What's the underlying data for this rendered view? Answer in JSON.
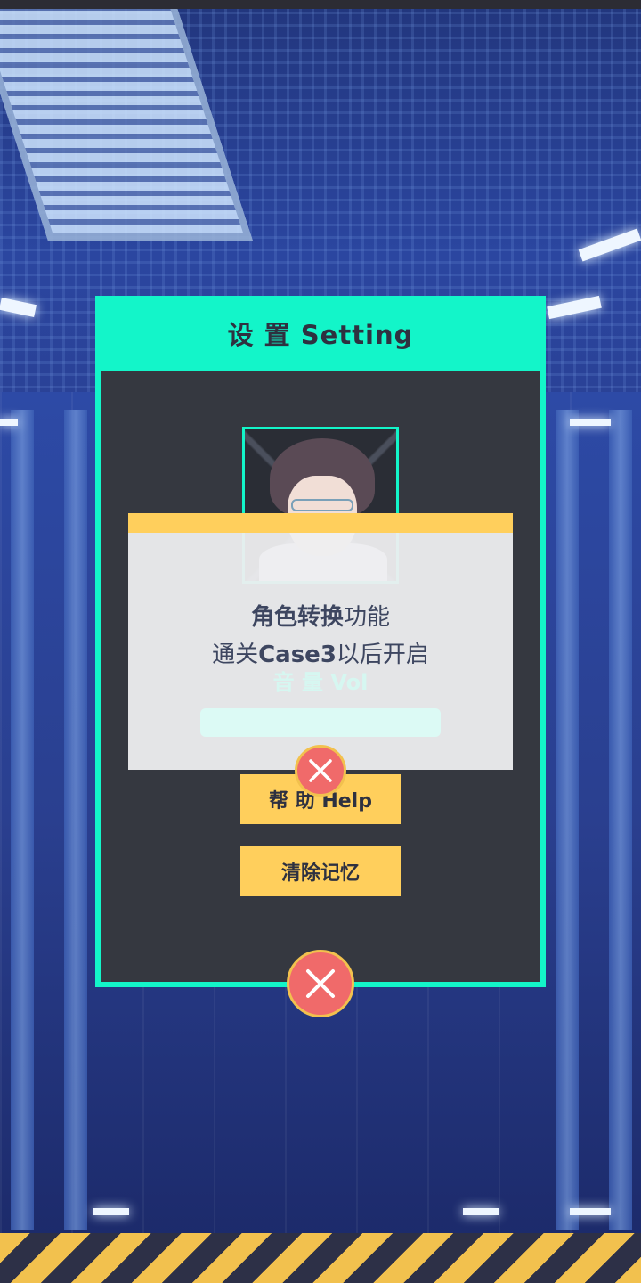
{
  "settings": {
    "title": "设 置 Setting",
    "help_label": "帮 助 Help",
    "clear_label": "清除记忆",
    "volume_label": "音 量 Vol",
    "volume_level": null
  },
  "popup": {
    "line1_bold": "角色转换",
    "line1_rest": "功能",
    "line2_prefix": "通关",
    "line2_bold": "Case3",
    "line2_rest": "以后开启"
  },
  "colors": {
    "accent_teal": "#13f5c9",
    "button_yellow": "#ffcf5c",
    "close_red": "#f06a6a",
    "panel_dark": "#353840"
  },
  "icons": {
    "close": "close-icon"
  }
}
